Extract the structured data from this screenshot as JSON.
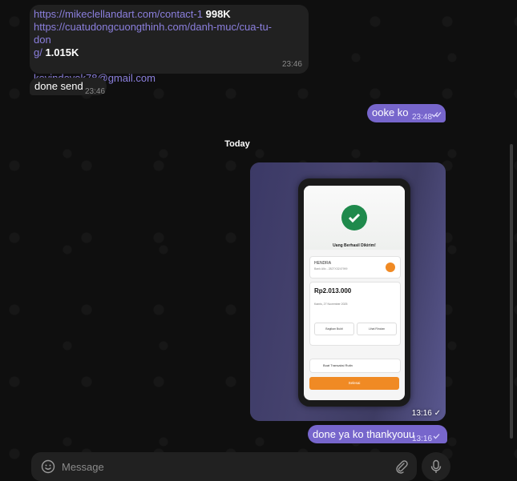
{
  "messages": {
    "links": {
      "line1_link": "https://mikeclellandart.com/contact-1",
      "line1_size": "998K",
      "line2_link": "https://cuatudongcuongthinh.com/danh-muc/cua-tu-don",
      "line3_link": "g/",
      "line3_size": "1.015K",
      "email": "kevindoyok78@gmail.com",
      "time": "23:46"
    },
    "done": {
      "text": "done send",
      "time": "23:46"
    },
    "ooke": {
      "text": "ooke ko",
      "time": "23:48"
    },
    "photo": {
      "time": "13:16",
      "screen": {
        "title": "Uang Berhasil Dikirim!",
        "recipient": "HENDRA",
        "recipient_sub": "Bank Allo - 2827X3247999",
        "amount": "Rp2.013.000",
        "date_label": "Tanggal transfer",
        "date": "Kamis, 27 November 2025",
        "time_label": "Waktu",
        "time_value": "13:14",
        "btn_share": "Bagikan Bukti",
        "btn_receipt": "Lihat Rincian",
        "routine": "Buat Transaksi Rutin",
        "done_button": "Selesai"
      }
    },
    "thanks": {
      "text": "done ya ko thankyouu",
      "time": "13:16"
    }
  },
  "date_separator": "Today",
  "composer": {
    "placeholder": "Message"
  },
  "colors": {
    "outgoing": "#7766cc",
    "incoming": "#212121",
    "link": "#8b7fdd"
  }
}
